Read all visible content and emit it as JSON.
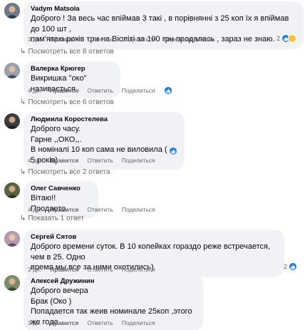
{
  "comments": [
    {
      "author": "Vadym Matsola",
      "lines": [
        "Доброго ! За весь час впіймав 3 такі , в порівнянні з 25 коп їх я впіймав до 100 шт ,",
        "пам'ятаю років три на Віоліті за 100 грн продалась , зараз не знаю."
      ],
      "time": "3 дн.",
      "like": "Нравится",
      "reply": "Ответить",
      "share": "Поделиться",
      "edited": "Отредактировано",
      "reactions": "2",
      "more_replies": "Посмотреть все 8 ответов"
    },
    {
      "author": "Валерка Крюгер",
      "lines": [
        "Викришка \"око\" називається"
      ],
      "time": "4 дн.",
      "like": "Нравится",
      "reply": "Ответить",
      "share": "Поделиться",
      "more_replies": "Посмотреть все 6 ответов"
    },
    {
      "author": "Людмила Коростелева",
      "lines": [
        "Доброго часу.",
        "Гарне ,,ОКО,,.",
        "В номіналі 10 коп сама не виловила ( за 5 років)"
      ],
      "time": "4 дн.",
      "like": "Нравится",
      "reply": "Ответить",
      "share": "Поделиться",
      "more_replies": "Посмотреть все 2 ответа"
    },
    {
      "author": "Олег Савченко",
      "lines": [
        "Вітаю!! Продаете."
      ],
      "time": "4 дн.",
      "like": "Нравится",
      "reply": "Ответить",
      "share": "Поделиться",
      "more_replies": "Показать 1 ответ"
    },
    {
      "author": "Сергей Сятов",
      "lines": [
        "Доброго времени суток. В 10 копейках гораздо реже встречается, чем в 25. Одно",
        "время мы все за ними охотились)"
      ],
      "time": "3 дн.",
      "like": "Нравится",
      "reply": "Ответить",
      "share": "Поделиться",
      "reactions": "2"
    },
    {
      "author": "Алексей Дружинин",
      "lines": [
        "Доброго вечера",
        "Брак (Око )",
        "Попадается так жеив номинале 25коп ,этого же года"
      ],
      "time": "3 дн.",
      "like": "Нравится",
      "reply": "Ответить",
      "share": "Поделиться"
    }
  ],
  "colors": {
    "bubble": "#f0f2f5",
    "meta": "#65676b",
    "like_blue": "#1877f2",
    "laugh_yellow": "#f7c33b"
  },
  "icons": [
    "like-reaction-icon",
    "laugh-reaction-icon",
    "reply-arrow-icon"
  ]
}
